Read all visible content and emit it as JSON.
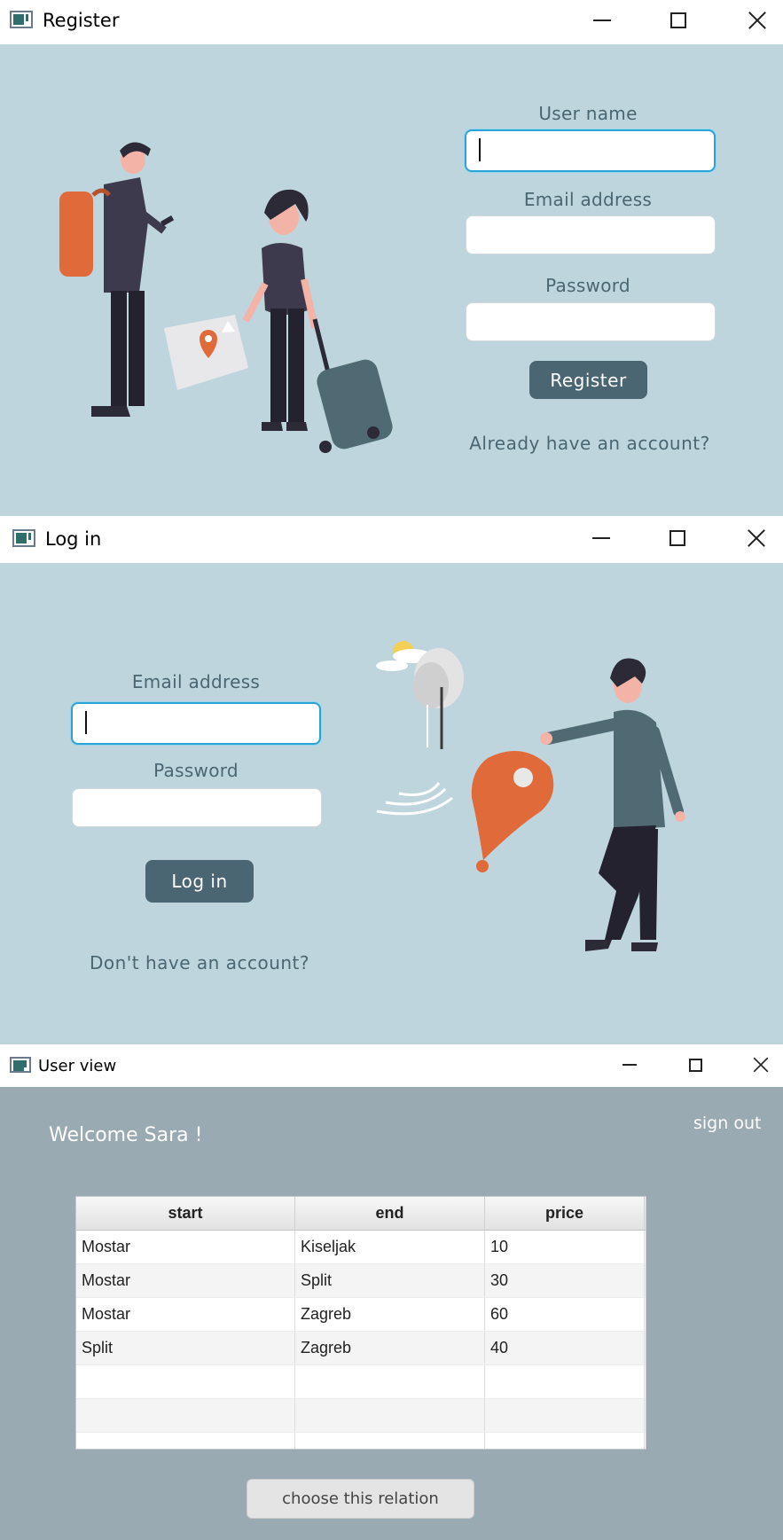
{
  "register_window": {
    "title": "Register",
    "username_label": "User name",
    "email_label": "Email address",
    "password_label": "Password",
    "register_button": "Register",
    "login_link": "Already have an account?"
  },
  "login_window": {
    "title": "Log in",
    "email_label": "Email address",
    "password_label": "Password",
    "login_button": "Log in",
    "signup_link": "Don't have an account?"
  },
  "user_window": {
    "title": "User view",
    "welcome_text": "Welcome Sara !",
    "signout_link": "sign out",
    "table": {
      "headers": [
        "start",
        "end",
        "price"
      ],
      "rows": [
        [
          "Mostar",
          "Kiseljak",
          "10"
        ],
        [
          "Mostar",
          "Split",
          "30"
        ],
        [
          "Mostar",
          "Zagreb",
          "60"
        ],
        [
          "Split",
          "Zagreb",
          "40"
        ],
        [
          "",
          "",
          ""
        ],
        [
          "",
          "",
          ""
        ],
        [
          "",
          "",
          ""
        ]
      ]
    },
    "choose_button": "choose this relation"
  },
  "colors": {
    "panel_bg": "#bfd5dd",
    "user_bg": "#9aaab3",
    "accent": "#4a6672",
    "focus_ring": "#2aa4d6",
    "pin_orange": "#e06a3a"
  }
}
